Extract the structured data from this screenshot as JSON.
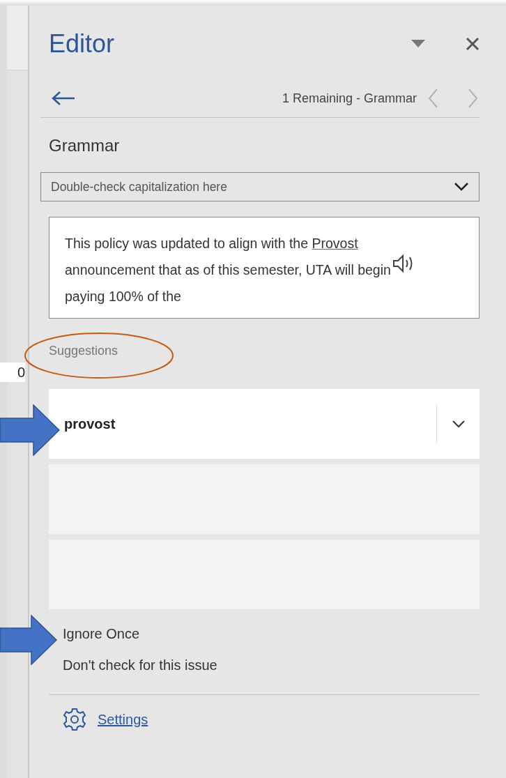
{
  "document": {
    "fragment": "0"
  },
  "pane": {
    "title": "Editor",
    "nav": {
      "status": "1 Remaining - Grammar"
    },
    "category": "Grammar",
    "issue_dropdown": {
      "value": "Double-check capitalization here"
    },
    "context": {
      "before": "This policy was updated to align with the",
      "flagged": "Provost",
      "after": "announcement that as of this semester, UTA will begin paying 100% of the"
    },
    "suggestions_label": "Suggestions",
    "suggestions": [
      {
        "text": "provost"
      }
    ],
    "actions": [
      "Ignore Once",
      "Don't check for this issue"
    ],
    "settings_link": "Settings"
  }
}
